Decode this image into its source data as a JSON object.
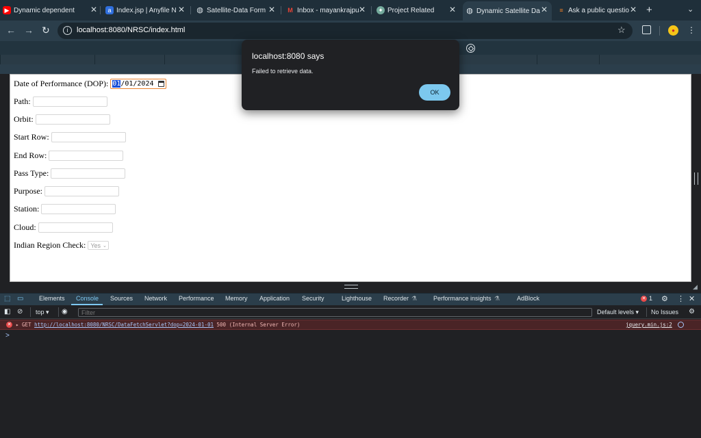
{
  "browser": {
    "tabs": [
      {
        "label": "Dynamic dependent",
        "favicon": "youtube-icon",
        "color": "#ff0000",
        "glyph": "▶"
      },
      {
        "label": "Index.jsp | Anyfile N",
        "favicon": "anyfile-icon",
        "color": "#2f6fde",
        "glyph": "a"
      },
      {
        "label": "Satellite-Data Form",
        "favicon": "globe-icon",
        "color": "#9aa5ab",
        "glyph": "◍"
      },
      {
        "label": "Inbox - mayankrajpu",
        "favicon": "gmail-icon",
        "color": "#ea4335",
        "glyph": "M"
      },
      {
        "label": "Project Related",
        "favicon": "chatgpt-icon",
        "color": "#74aa9c",
        "glyph": "✦"
      },
      {
        "label": "Dynamic Satellite Da",
        "favicon": "globe-icon",
        "color": "#9aa5ab",
        "glyph": "◍"
      },
      {
        "label": "Ask a public questio",
        "favicon": "stackoverflow-icon",
        "color": "#f48024",
        "glyph": "≡"
      }
    ],
    "new_tab": "+",
    "url": "localhost:8080/NRSC/index.html"
  },
  "form": {
    "dop_label": "Date of Performance (DOP):",
    "dop_month": "01",
    "dop_rest": "/01/2024",
    "path_label": "Path:",
    "orbit_label": "Orbit:",
    "start_row_label": "Start Row:",
    "end_row_label": "End Row:",
    "pass_type_label": "Pass Type:",
    "purpose_label": "Purpose:",
    "station_label": "Station:",
    "cloud_label": "Cloud:",
    "indian_region_label": "Indian Region Check:",
    "indian_region_value": "Yes"
  },
  "dialog": {
    "title": "localhost:8080 says",
    "message": "Failed to retrieve data.",
    "ok": "OK"
  },
  "devtools": {
    "tabs": [
      "Elements",
      "Console",
      "Sources",
      "Network",
      "Performance",
      "Memory",
      "Application",
      "Security",
      "Lighthouse",
      "Recorder",
      "Performance insights",
      "AdBlock"
    ],
    "active_tab": "Console",
    "error_count": "1",
    "context": "top",
    "filter_placeholder": "Filter",
    "levels": "Default levels",
    "issues": "No Issues",
    "error": {
      "method": "GET",
      "url": "http://localhost:8080/NRSC/DataFetchServlet?dop=2024-01-01",
      "status": "500 (Internal Server Error)",
      "source": "jquery.min.js:2"
    },
    "prompt": ">"
  }
}
